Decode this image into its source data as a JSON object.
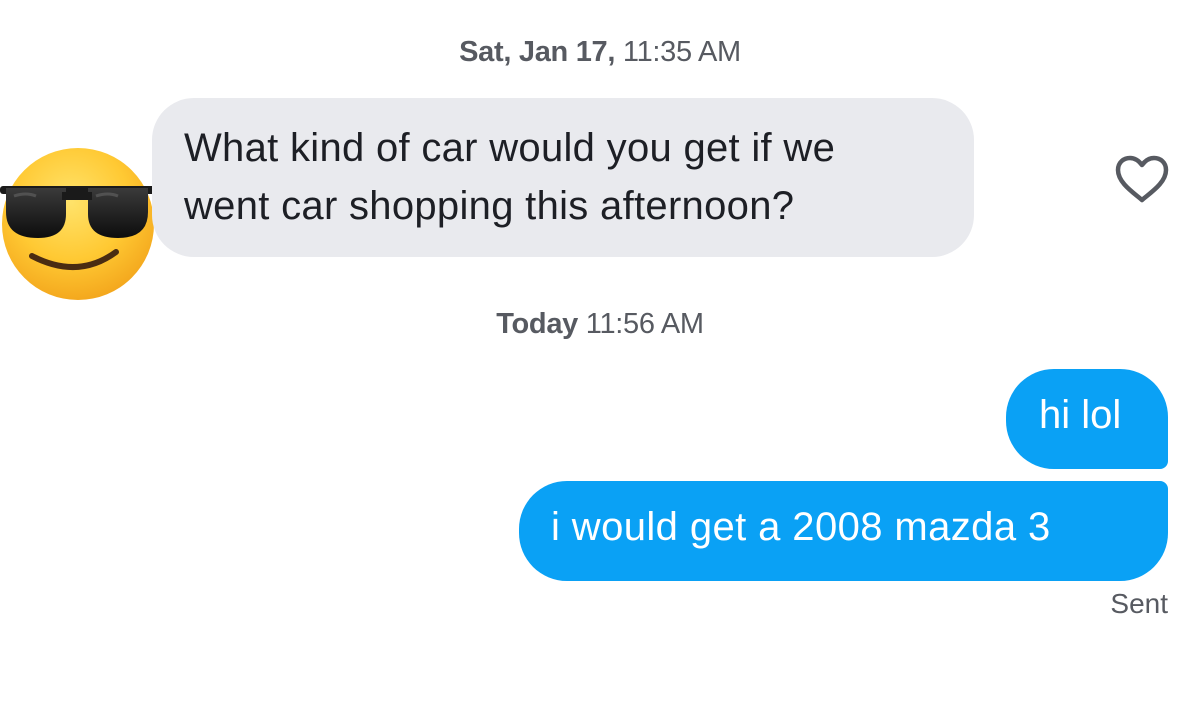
{
  "conversation": {
    "timestamps": [
      {
        "bold": "Sat, Jan 17,",
        "normal": "11:35 AM"
      },
      {
        "bold": "Today",
        "normal": "11:56 AM"
      }
    ],
    "received": [
      {
        "text_line1": "What kind of car would you get if we",
        "text_line2": "went car shopping this afternoon?"
      }
    ],
    "sent_messages": [
      {
        "text": "hi lol"
      },
      {
        "text": "i would get a 2008 mazda 3"
      }
    ],
    "status": "Sent"
  },
  "avatar": {
    "icon": "sunglasses-emoji-icon"
  },
  "like": {
    "icon": "heart-icon",
    "liked": false
  },
  "colors": {
    "sent_bubble": "#0aa1f5",
    "received_bubble": "#e9eaee",
    "meta_text": "#575a61"
  }
}
